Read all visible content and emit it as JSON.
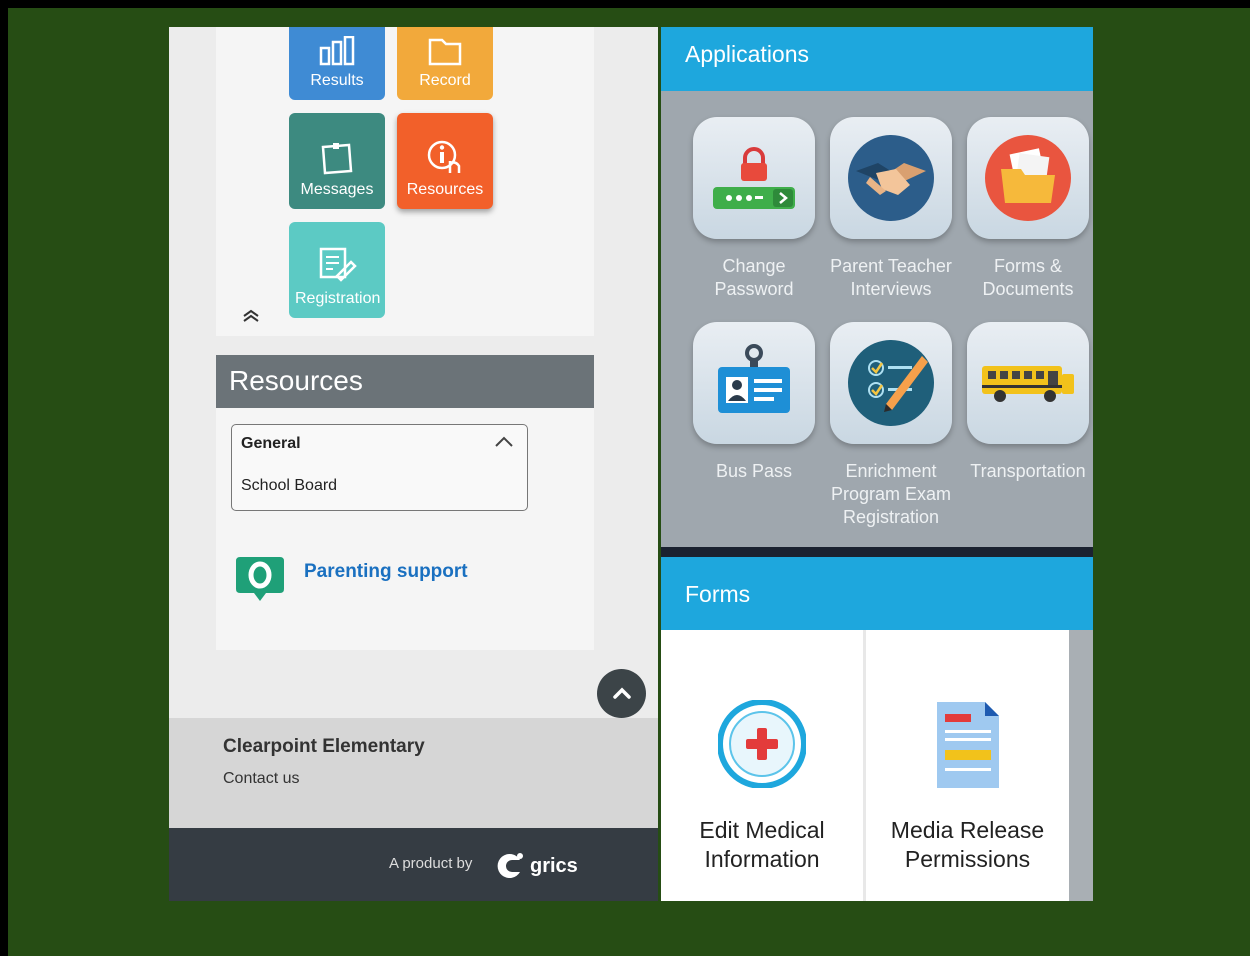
{
  "tiles": [
    {
      "label": "Results",
      "icon": "bar-chart-icon",
      "color": "#3f8bd4"
    },
    {
      "label": "Record",
      "icon": "folder-icon",
      "color": "#f2a93b"
    },
    {
      "label": "Messages",
      "icon": "note-icon",
      "color": "#3d8a80"
    },
    {
      "label": "Resources",
      "icon": "info-touch-icon",
      "color": "#f2602a"
    },
    {
      "label": "Registration",
      "icon": "edit-form-icon",
      "color": "#5ccac4"
    }
  ],
  "resources": {
    "title": "Resources",
    "group": "General",
    "item": "School Board",
    "parenting_link": "Parenting support"
  },
  "footer": {
    "school_name": "Clearpoint Elementary",
    "contact": "Contact us",
    "product_by": "A product by",
    "brand": "grics"
  },
  "applications": {
    "title": "Applications",
    "items": [
      {
        "label": "Change Password",
        "icon": "password-lock-icon"
      },
      {
        "label": "Parent Teacher Interviews",
        "icon": "handshake-icon"
      },
      {
        "label": "Forms & Documents",
        "icon": "folder-documents-icon"
      },
      {
        "label": "Bus Pass",
        "icon": "id-badge-icon"
      },
      {
        "label": "Enrichment Program Exam Registration",
        "icon": "checklist-pencil-icon"
      },
      {
        "label": "Transportation",
        "icon": "school-bus-icon"
      }
    ]
  },
  "forms": {
    "title": "Forms",
    "items": [
      {
        "label": "Edit Medical Information",
        "icon": "medical-cross-icon"
      },
      {
        "label": "Media Release Permissions",
        "icon": "document-icon"
      }
    ]
  }
}
